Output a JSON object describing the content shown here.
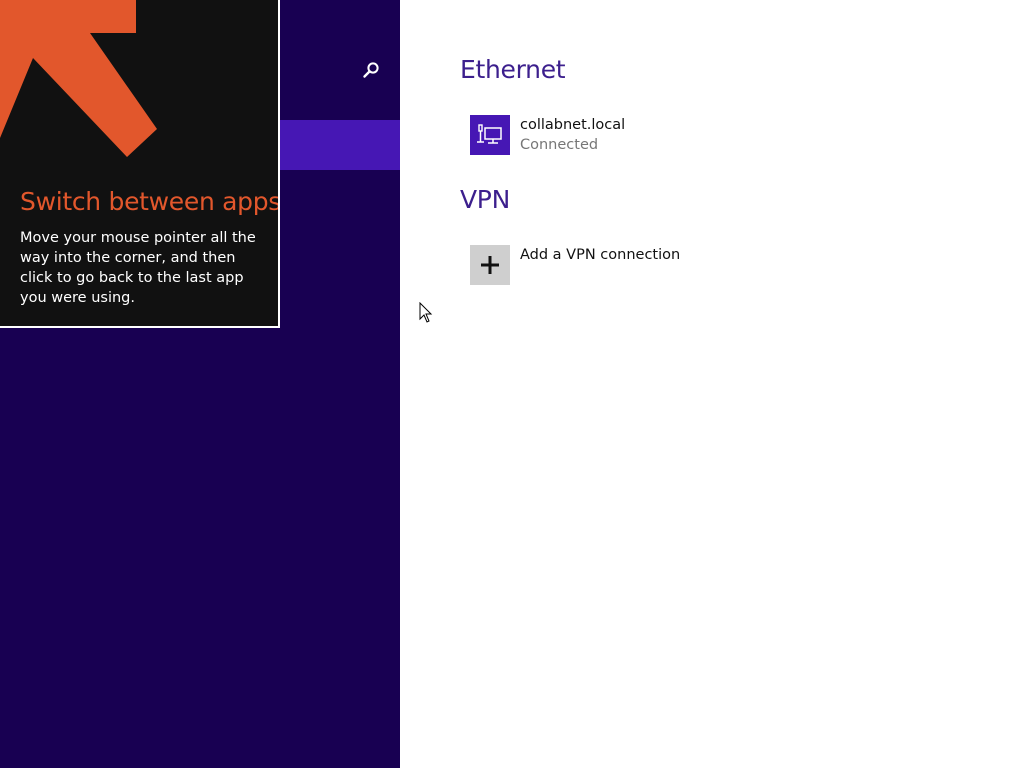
{
  "tip": {
    "title": "Switch between apps",
    "body": "Move your mouse pointer all the way into the corner, and then click to go back to the last app you were using.",
    "accent_color": "#e2572c",
    "icon": "arrow-up-left-icon"
  },
  "left_pane": {
    "background_color": "#180052",
    "highlight_color": "#4617b4",
    "search_icon": "search-icon"
  },
  "settings": {
    "ethernet": {
      "title": "Ethernet",
      "network": {
        "name": "collabnet.local",
        "status": "Connected",
        "icon": "ethernet-network-icon"
      }
    },
    "vpn": {
      "title": "VPN",
      "add_label": "Add a VPN connection",
      "icon": "plus-icon"
    }
  }
}
